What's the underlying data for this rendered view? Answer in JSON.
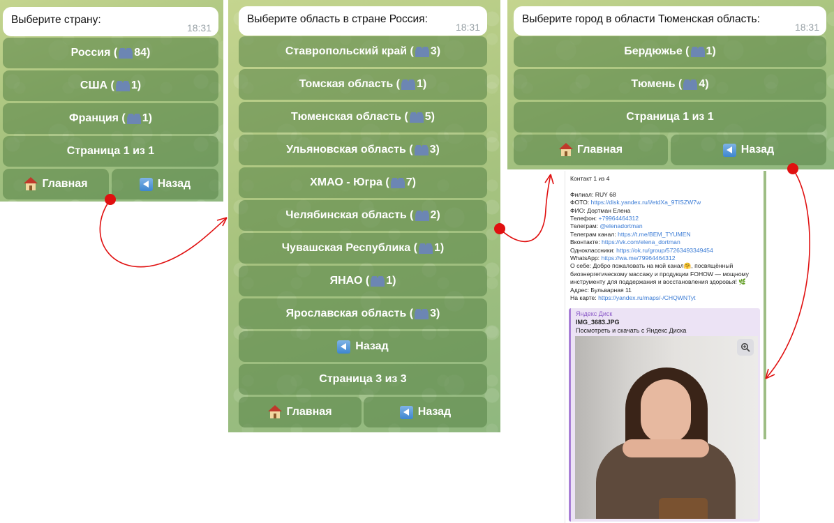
{
  "panel1": {
    "message": "Выберите страну:",
    "time": "18:31",
    "buttons": [
      {
        "label": "Россия (",
        "count": "84)"
      },
      {
        "label": "США (",
        "count": "1)"
      },
      {
        "label": "Франция (",
        "count": "1)"
      }
    ],
    "page": "Страница 1 из 1",
    "home": "Главная",
    "back": "Назад"
  },
  "panel2": {
    "message": "Выберите область в стране Россия:",
    "time": "18:31",
    "buttons": [
      {
        "label": "Ставропольский край (",
        "count": "3)"
      },
      {
        "label": "Томская область (",
        "count": "1)"
      },
      {
        "label": "Тюменская область (",
        "count": "5)"
      },
      {
        "label": "Ульяновская область (",
        "count": "3)"
      },
      {
        "label": "ХМАО - Югра (",
        "count": "7)"
      },
      {
        "label": "Челябинская область (",
        "count": "2)"
      },
      {
        "label": "Чувашская Республика (",
        "count": "1)"
      },
      {
        "label": "ЯНАО (",
        "count": "1)"
      },
      {
        "label": "Ярославская область (",
        "count": "3)"
      }
    ],
    "back_row": "Назад",
    "page": "Страница 3 из 3",
    "home": "Главная",
    "back": "Назад"
  },
  "panel3": {
    "message": "Выберите город в области Тюменская область:",
    "time": "18:31",
    "buttons": [
      {
        "label": "Бердюжье (",
        "count": "1)"
      },
      {
        "label": "Тюмень (",
        "count": "4)"
      }
    ],
    "page": "Страница 1 из 1",
    "home": "Главная",
    "back": "Назад"
  },
  "contact": {
    "header": "Контакт 1 из 4",
    "branch_label": "Филиал:",
    "branch": "RUY 68",
    "photo_label": "ФОТО:",
    "photo_link": "https://disk.yandex.ru/i/etdXa_9TISZW7w",
    "name_label": "ФИО:",
    "name": "Дортман Елена",
    "phone_label": "Телефон:",
    "phone": "+79964464312",
    "telegram_label": "Телеграм:",
    "telegram": "@elenadortman",
    "tg_channel_label": "Телеграм канал:",
    "tg_channel": "https://t.me/BEM_TYUMEN",
    "vk_label": "Вконтакте:",
    "vk": "https://vk.com/elena_dortman",
    "ok_label": "Одноклассники:",
    "ok": "https://ok.ru/group/57263493349454",
    "wa_label": "WhatsApp:",
    "wa": "https://wa.me/79964464312",
    "about_label": "О себе:",
    "about": "Добро пожаловать на мой канал🤗, посвящённый биоэнергетическому массажу и продукции FOHOW — мощному инструменту для поддержания и восстановления здоровья! 🌿",
    "address_label": "Адрес:",
    "address": "Бульварная 11",
    "map_label": "На карте:",
    "map": "https://yandex.ru/maps/-/CHQWNTyt",
    "preview_source": "Яндекс Диск",
    "preview_file": "IMG_3683.JPG",
    "preview_desc": "Посмотреть и скачать с Яндекс Диска"
  },
  "colors": {
    "arrow": "#e01010",
    "button_bg": "#6f9a5c",
    "link": "#3a7bd5"
  }
}
